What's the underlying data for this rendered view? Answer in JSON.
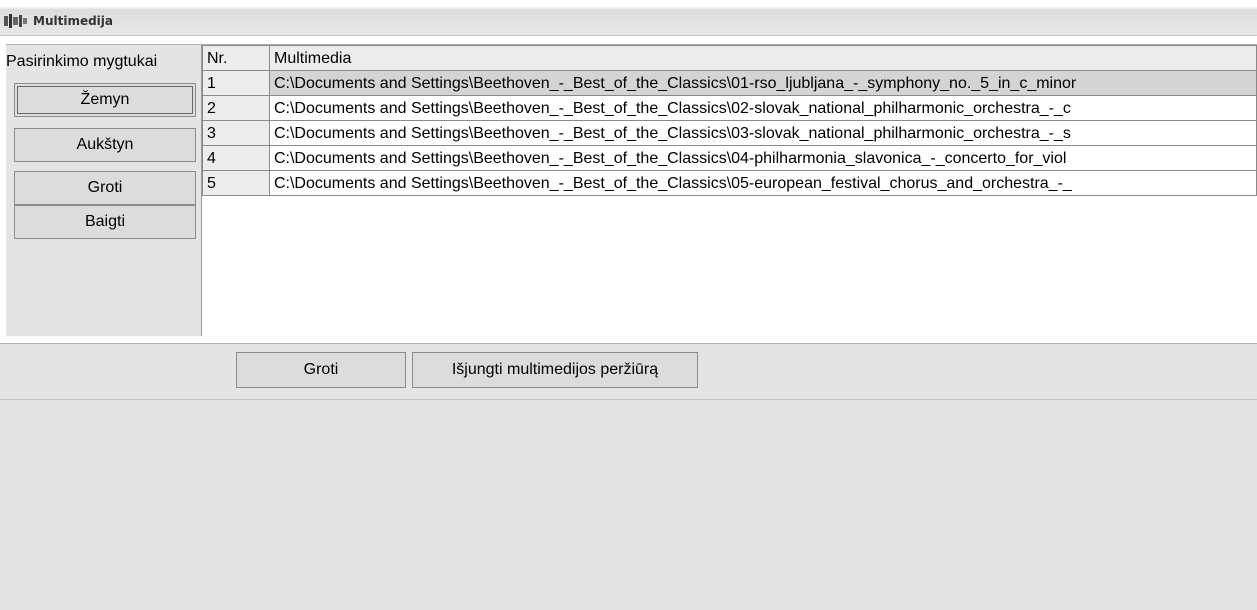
{
  "window": {
    "title": "Multimedija",
    "icon": "app-icon"
  },
  "sidebar": {
    "label": "Pasirinkimo mygtukai",
    "buttons": [
      {
        "label": "Žemyn"
      },
      {
        "label": "Aukštyn"
      },
      {
        "label": "Groti"
      },
      {
        "label": "Baigti"
      }
    ]
  },
  "table": {
    "headers": [
      "Nr.",
      "Multimedia"
    ],
    "rows": [
      {
        "nr": "1",
        "path": "C:\\Documents and Settings\\Beethoven_-_Best_of_the_Classics\\01-rso_ljubljana_-_symphony_no._5_in_c_minor"
      },
      {
        "nr": "2",
        "path": "C:\\Documents and Settings\\Beethoven_-_Best_of_the_Classics\\02-slovak_national_philharmonic_orchestra_-_c"
      },
      {
        "nr": "3",
        "path": "C:\\Documents and Settings\\Beethoven_-_Best_of_the_Classics\\03-slovak_national_philharmonic_orchestra_-_s"
      },
      {
        "nr": "4",
        "path": "C:\\Documents and Settings\\Beethoven_-_Best_of_the_Classics\\04-philharmonia_slavonica_-_concerto_for_viol"
      },
      {
        "nr": "5",
        "path": "C:\\Documents and Settings\\Beethoven_-_Best_of_the_Classics\\05-european_festival_chorus_and_orchestra_-_"
      }
    ]
  },
  "footer": {
    "play_label": "Groti",
    "close_preview_label": "Išjungti multimedijos peržiūrą"
  }
}
